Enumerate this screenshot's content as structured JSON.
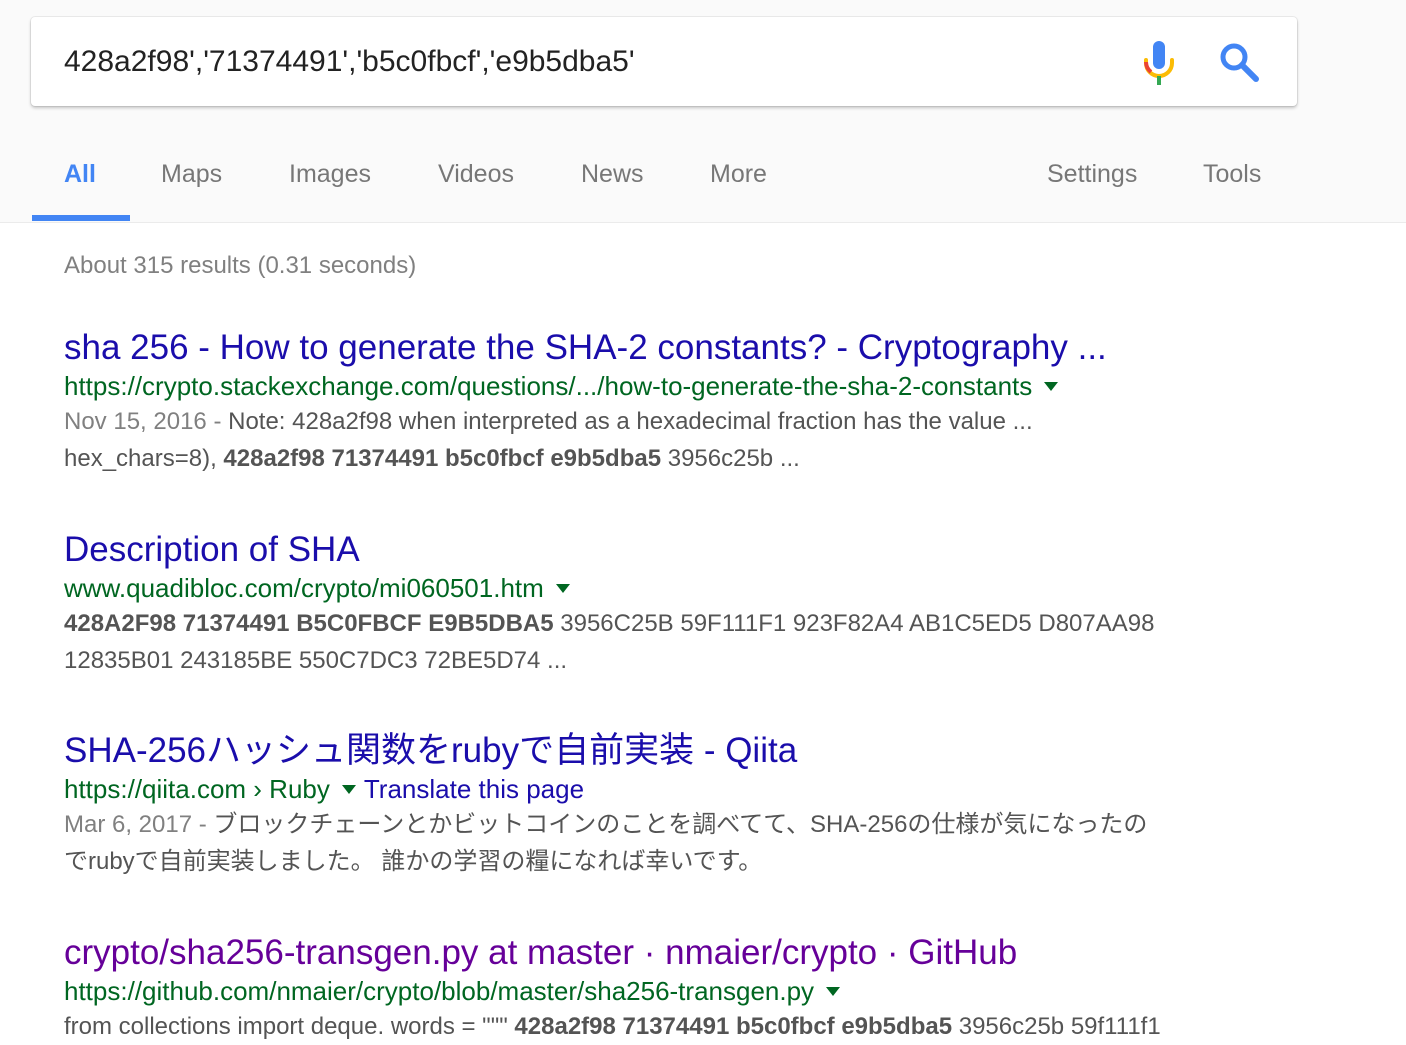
{
  "search": {
    "query": "428a2f98','71374491','b5c0fbcf','e9b5dba5'"
  },
  "tabs": [
    {
      "label": "All"
    },
    {
      "label": "Maps"
    },
    {
      "label": "Images"
    },
    {
      "label": "Videos"
    },
    {
      "label": "News"
    },
    {
      "label": "More"
    },
    {
      "label": "Settings"
    },
    {
      "label": "Tools"
    }
  ],
  "stats": "About 315 results (0.31 seconds)",
  "results": [
    {
      "title": "sha 256 - How to generate the SHA-2 constants? - Cryptography ...",
      "url": "https://crypto.stackexchange.com/questions/.../how-to-generate-the-sha-2-constants",
      "date": "Nov 15, 2016 - ",
      "snippet1": "Note: 428a2f98 when interpreted as a hexadecimal fraction has the value ...",
      "snippet2_pre": "hex_chars=8), ",
      "snippet2_bold": "428a2f98 71374491 b5c0fbcf e9b5dba5",
      "snippet2_post": " 3956c25b ..."
    },
    {
      "title": "Description of SHA",
      "url": "www.quadibloc.com/crypto/mi060501.htm",
      "snippet1_bold": "428A2F98 71374491 B5C0FBCF E9B5DBA5",
      "snippet1_post": " 3956C25B 59F111F1 923F82A4 AB1C5ED5 D807AA98",
      "snippet2": "12835B01 243185BE 550C7DC3 72BE5D74 ..."
    },
    {
      "title": "SHA-256ハッシュ関数をrubyで自前実装 - Qiita",
      "url": "https://qiita.com › Ruby",
      "translate": "Translate this page",
      "date": "Mar 6, 2017 - ",
      "snippet1": "ブロックチェーンとかビットコインのことを調べてて、SHA-256の仕様が気になったの",
      "snippet2": "でrubyで自前実装しました。 誰かの学習の糧になれば幸いです。"
    },
    {
      "title": "crypto/sha256-transgen.py at master · nmaier/crypto · GitHub",
      "url": "https://github.com/nmaier/crypto/blob/master/sha256-transgen.py",
      "snippet1_pre": "from collections import deque. words = \"\"\" ",
      "snippet1_bold": "428a2f98 71374491 b5c0fbcf e9b5dba5",
      "snippet1_post": " 3956c25b 59f111f1"
    }
  ],
  "colors": {
    "link": "#1a0dab",
    "visited": "#660099",
    "url": "#006621",
    "accent": "#4285f4"
  },
  "icons": {
    "mic": "mic-icon",
    "search": "search-icon"
  }
}
